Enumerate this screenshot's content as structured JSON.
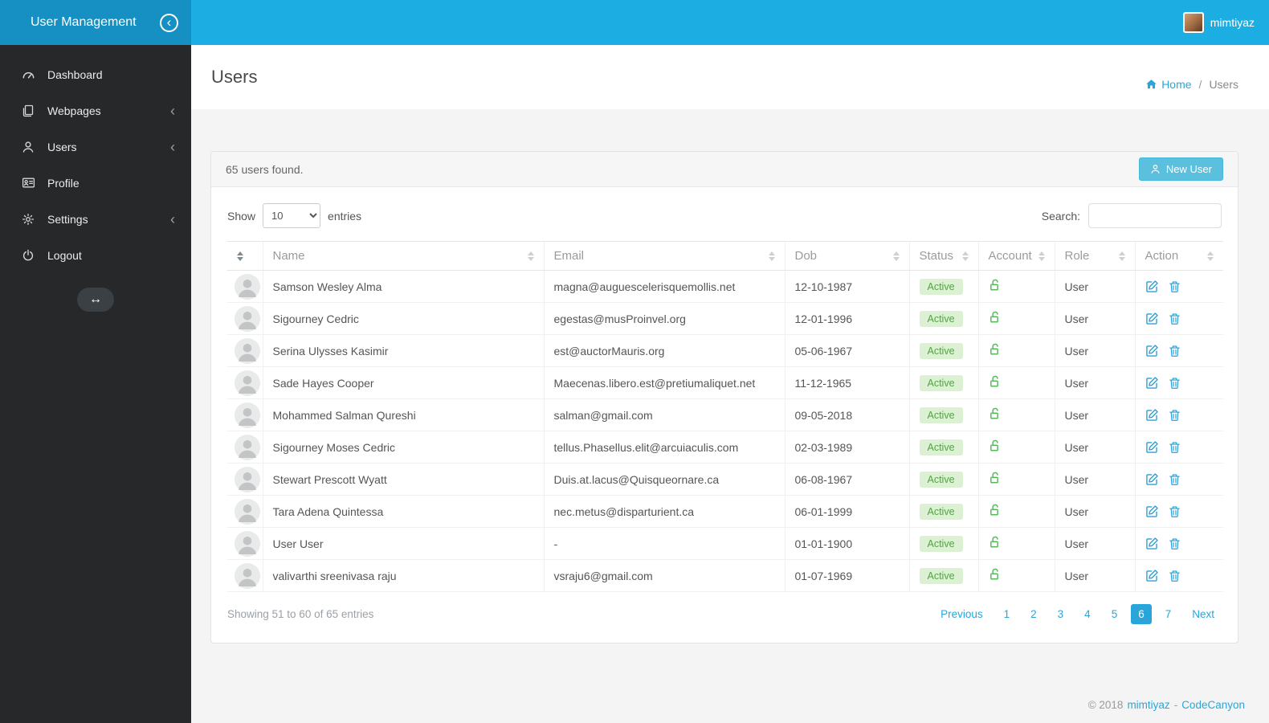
{
  "topbar": {
    "title": "User Management",
    "username": "mimtiyaz"
  },
  "sidebar": {
    "items": [
      {
        "label": "Dashboard",
        "icon": "dashboard-icon",
        "has_submenu": false
      },
      {
        "label": "Webpages",
        "icon": "pages-icon",
        "has_submenu": true
      },
      {
        "label": "Users",
        "icon": "user-icon",
        "has_submenu": true
      },
      {
        "label": "Profile",
        "icon": "id-card-icon",
        "has_submenu": false
      },
      {
        "label": "Settings",
        "icon": "gear-icon",
        "has_submenu": true
      },
      {
        "label": "Logout",
        "icon": "power-icon",
        "has_submenu": false
      }
    ]
  },
  "page": {
    "title": "Users",
    "breadcrumb_home": "Home",
    "breadcrumb_separator": "/",
    "breadcrumb_current": "Users"
  },
  "card": {
    "summary": "65 users found.",
    "new_user_button": "New User",
    "show_label": "Show",
    "page_size": "10",
    "entries_label": "entries",
    "search_label": "Search:",
    "search_value": ""
  },
  "table": {
    "columns": [
      "Name",
      "Email",
      "Dob",
      "Status",
      "Account",
      "Role",
      "Action"
    ],
    "rows": [
      {
        "name": "Samson Wesley Alma",
        "email": "magna@auguescelerisquemollis.net",
        "dob": "12-10-1987",
        "status": "Active",
        "account": "unlocked",
        "role": "User"
      },
      {
        "name": "Sigourney Cedric",
        "email": "egestas@musProinvel.org",
        "dob": "12-01-1996",
        "status": "Active",
        "account": "unlocked",
        "role": "User"
      },
      {
        "name": "Serina Ulysses Kasimir",
        "email": "est@auctorMauris.org",
        "dob": "05-06-1967",
        "status": "Active",
        "account": "unlocked",
        "role": "User"
      },
      {
        "name": "Sade Hayes Cooper",
        "email": "Maecenas.libero.est@pretiumaliquet.net",
        "dob": "11-12-1965",
        "status": "Active",
        "account": "unlocked",
        "role": "User"
      },
      {
        "name": "Mohammed Salman Qureshi",
        "email": "salman@gmail.com",
        "dob": "09-05-2018",
        "status": "Active",
        "account": "unlocked",
        "role": "User"
      },
      {
        "name": "Sigourney Moses Cedric",
        "email": "tellus.Phasellus.elit@arcuiaculis.com",
        "dob": "02-03-1989",
        "status": "Active",
        "account": "unlocked",
        "role": "User"
      },
      {
        "name": "Stewart Prescott Wyatt",
        "email": "Duis.at.lacus@Quisqueornare.ca",
        "dob": "06-08-1967",
        "status": "Active",
        "account": "unlocked",
        "role": "User"
      },
      {
        "name": "Tara Adena Quintessa",
        "email": "nec.metus@disparturient.ca",
        "dob": "06-01-1999",
        "status": "Active",
        "account": "unlocked",
        "role": "User"
      },
      {
        "name": "User User",
        "email": "-",
        "dob": "01-01-1900",
        "status": "Active",
        "account": "unlocked",
        "role": "User"
      },
      {
        "name": "valivarthi sreenivasa raju",
        "email": "vsraju6@gmail.com",
        "dob": "01-07-1969",
        "status": "Active",
        "account": "unlocked",
        "role": "User"
      }
    ]
  },
  "table_footer": {
    "showing_text": "Showing 51 to 60 of 65 entries",
    "pagination": [
      {
        "label": "Previous",
        "active": false
      },
      {
        "label": "1",
        "active": false
      },
      {
        "label": "2",
        "active": false
      },
      {
        "label": "3",
        "active": false
      },
      {
        "label": "4",
        "active": false
      },
      {
        "label": "5",
        "active": false
      },
      {
        "label": "6",
        "active": true
      },
      {
        "label": "7",
        "active": false
      },
      {
        "label": "Next",
        "active": false
      }
    ]
  },
  "footer": {
    "copyright": "© 2018",
    "author_link": "mimtiyaz",
    "separator": "-",
    "brand_link": "CodeCanyon"
  },
  "colors": {
    "topbar": "#1caee2",
    "topbar_brand": "#168fc2",
    "sidebar": "#26282a",
    "accent_blue": "#2aa5da",
    "info_button": "#5bc0de",
    "success_green": "#5cb85c",
    "badge_bg": "#dcf1d3",
    "badge_text": "#55a246"
  }
}
